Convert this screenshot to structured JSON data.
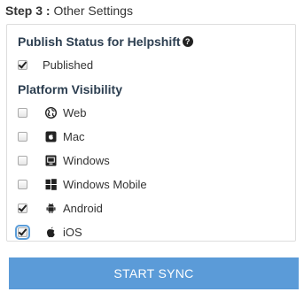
{
  "step": {
    "label": "Step 3 :",
    "title": "Other Settings"
  },
  "publish": {
    "heading": "Publish Status for Helpshift",
    "help_icon": "question-circle-icon",
    "option": {
      "label": "Published",
      "checked": true
    }
  },
  "platform": {
    "heading": "Platform Visibility",
    "items": [
      {
        "label": "Web",
        "icon": "globe-icon",
        "checked": false
      },
      {
        "label": "Mac",
        "icon": "mac-icon",
        "checked": false
      },
      {
        "label": "Windows",
        "icon": "windows-icon",
        "checked": false
      },
      {
        "label": "Windows Mobile",
        "icon": "windows-mobile-icon",
        "checked": false
      },
      {
        "label": "Android",
        "icon": "android-icon",
        "checked": true
      },
      {
        "label": "iOS",
        "icon": "apple-icon",
        "checked": true
      }
    ]
  },
  "actions": {
    "sync_label": "START SYNC",
    "sync_color": "#5b9bd8"
  }
}
